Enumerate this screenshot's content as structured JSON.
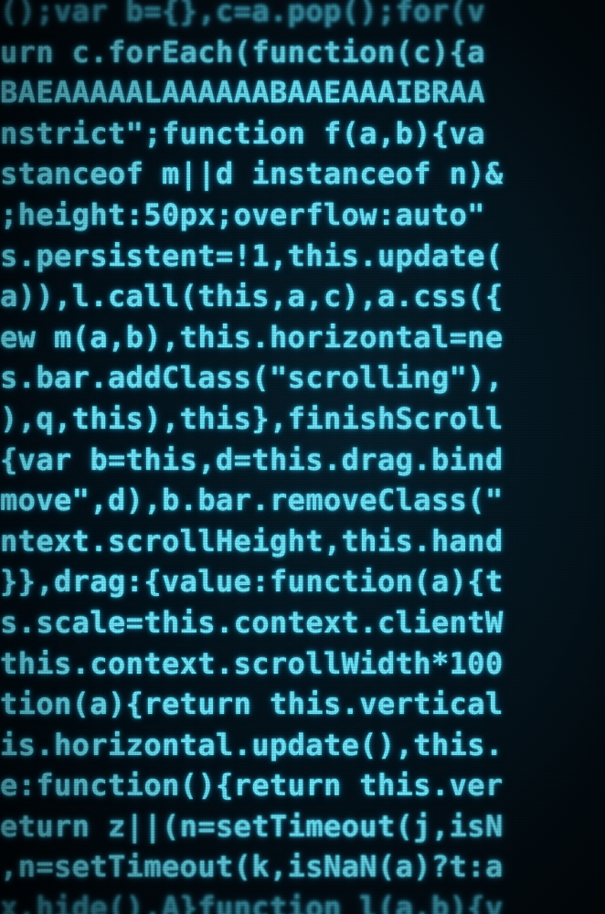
{
  "code_lines": [
    "();var b={},c=a.pop();for(v",
    "urn c.forEach(function(c){a",
    "BAEAAAAALAAAAAABAAEAAAIBRAA",
    "nstrict\";function f(a,b){va",
    "stanceof m||d instanceof n)&",
    ";height:50px;overflow:auto\"",
    "s.persistent=!1,this.update(",
    "a)),l.call(this,a,c),a.css({",
    "ew m(a,b),this.horizontal=ne",
    "s.bar.addClass(\"scrolling\"),",
    "),q,this),this},finishScroll",
    "{var b=this,d=this.drag.bind",
    "move\",d),b.bar.removeClass(\"",
    "ntext.scrollHeight,this.hand",
    "}},drag:{value:function(a){t",
    "s.scale=this.context.clientW",
    "this.context.scrollWidth*100",
    "tion(a){return this.vertical",
    "is.horizontal.update(),this.",
    "e:function(){return this.ver",
    "eturn z||(n=setTimeout(j,isN",
    ",n=setTimeout(k,isNaN(a)?t:a",
    "x.hide(),A}function l(a,b){v"
  ],
  "watermark_id": "227555644",
  "colors": {
    "background": "#020a10",
    "text": "#6fe3f5",
    "glow": "#2fb6d2"
  }
}
